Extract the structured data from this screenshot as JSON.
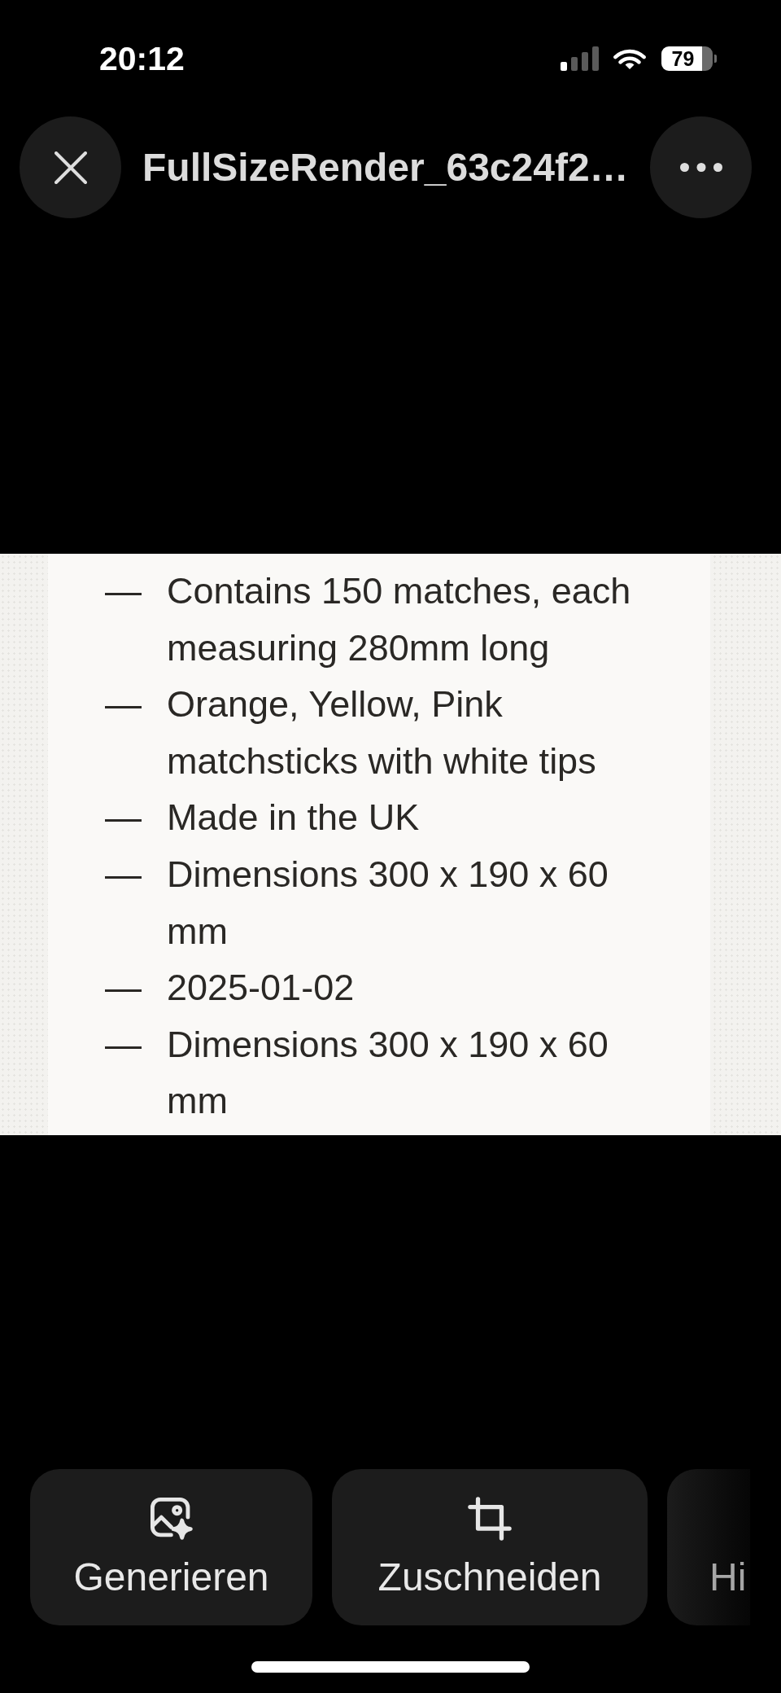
{
  "status_bar": {
    "time": "20:12",
    "battery_percent": "79"
  },
  "header": {
    "title": "FullSizeRender_63c24f2…"
  },
  "document": {
    "items": [
      {
        "bullet": "—",
        "text": "Contains 150 matches, each measuring 280mm long"
      },
      {
        "bullet": "—",
        "text": "Orange, Yellow, Pink matchsticks with white tips"
      },
      {
        "bullet": "—",
        "text": "Made in the UK"
      },
      {
        "bullet": "—",
        "text": "Dimensions 300 x 190 x 60 mm"
      },
      {
        "bullet": "—",
        "text": "2025-01-02"
      },
      {
        "bullet": "—",
        "text": "Dimensions 300 x 190 x 60 mm"
      }
    ]
  },
  "toolbar": {
    "actions": [
      {
        "kind": "generate",
        "label": "Generieren"
      },
      {
        "kind": "crop",
        "label": "Zuschneiden"
      },
      {
        "kind": "clipped",
        "label": "Hi"
      }
    ]
  }
}
